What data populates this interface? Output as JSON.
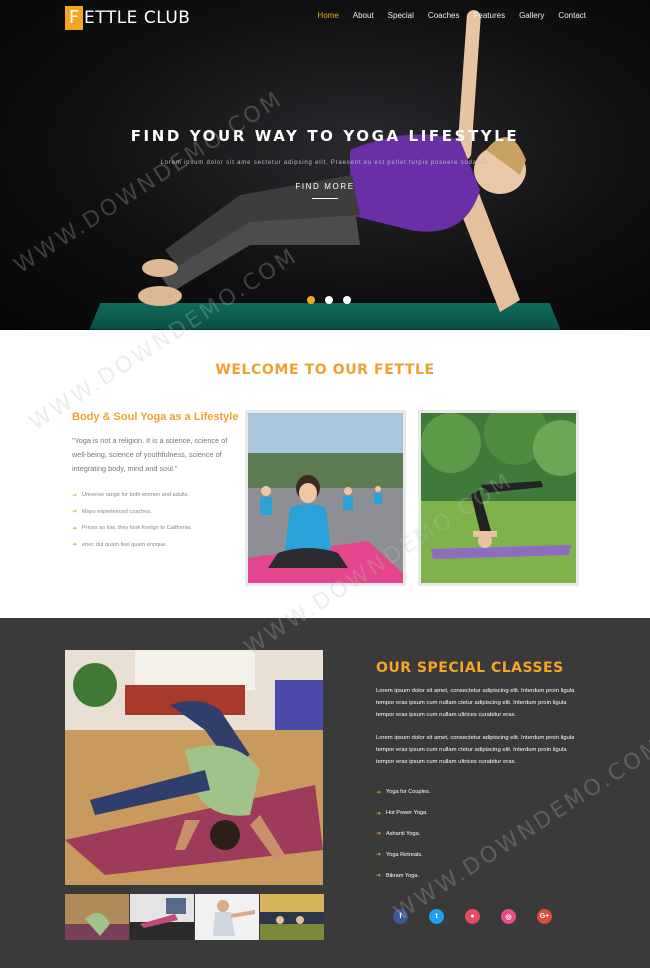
{
  "brand": {
    "initial": "F",
    "rest": "ETTLE CLUB"
  },
  "nav": [
    {
      "label": "Home",
      "active": true
    },
    {
      "label": "About"
    },
    {
      "label": "Special"
    },
    {
      "label": "Coaches"
    },
    {
      "label": "Features"
    },
    {
      "label": "Gallery"
    },
    {
      "label": "Contact"
    }
  ],
  "hero": {
    "title": "FIND YOUR WAY TO YOGA LIFESTYLE",
    "subtitle": "Lorem ipsum dolor sit ame sectetur adipsing elit. Praesent eu est pellet turpis posuere sodales.",
    "cta": "FIND MORE",
    "slides_total": 3,
    "slide_active": 1
  },
  "welcome": {
    "title": "WELCOME TO OUR FETTLE",
    "subtitle": "Body & Soul Yoga as a Lifestyle",
    "quote": "\"Yoga is not a religion. It is a science, science of well-being, science of youthfulness, science of integrating body, mind and soul.\"",
    "items": [
      "Universe range for both women and adults.",
      "Mayo experienced coaches.",
      "Prices so low, they look foreign to California.",
      "enec dut quam feel quam enoque."
    ]
  },
  "special": {
    "title": "OUR SPECIAL CLASSES",
    "para1": "Lorem ipsum dolor sit amet, consectetur adipiscing elit. Interdum proin ligula tempor eras ipsum cum nullam ctetur adipiscing elit. Interdum proin ligula tempor eras ipsum cum nullam ultrices curabitur eras.",
    "para2": "Lorem ipsum dolor sit amet, consectetur adipiscing elit. Interdum proin ligula tempor eras ipsum cum nullam ctetur adipiscing elit. Interdum proin ligula tempor eras ipsum cum nullam ultrices curabitur eras.",
    "classes": [
      "Yoga for Couples.",
      "Hot Power Yoga.",
      "Ashanti Yoga.",
      "Yoga Retreats.",
      "Bikram Yoga."
    ],
    "socials": [
      {
        "icon": "facebook-icon",
        "glyph": "f",
        "color": "#3b5998"
      },
      {
        "icon": "twitter-icon",
        "glyph": "t",
        "color": "#1da1f2"
      },
      {
        "icon": "dribbble-icon",
        "glyph": "●",
        "color": "#e44c65"
      },
      {
        "icon": "instagram-icon",
        "glyph": "◎",
        "color": "#ea4c89"
      },
      {
        "icon": "google-plus-icon",
        "glyph": "G+",
        "color": "#dd4b39"
      }
    ]
  },
  "colors": {
    "accent": "#f5a623",
    "dark": "#3a3a3a"
  },
  "watermark": "WWW.DOWNDEMO.COM"
}
